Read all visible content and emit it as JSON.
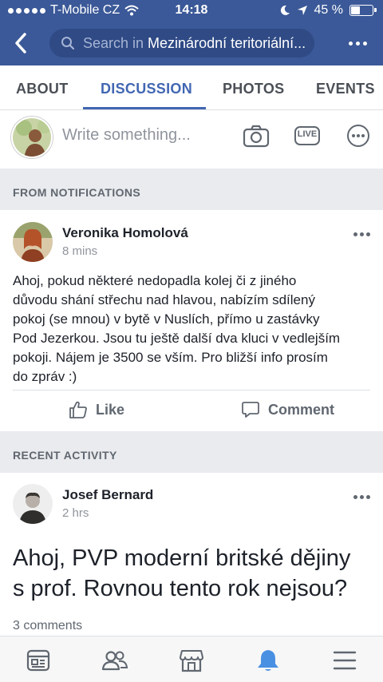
{
  "status_bar": {
    "carrier": "T-Mobile CZ",
    "time": "14:18",
    "battery": "45 %",
    "battery_level": 0.45
  },
  "header": {
    "search_prefix": "Search in",
    "search_page": "Mezinárodní teritoriální..."
  },
  "tabs": [
    {
      "label": "ABOUT"
    },
    {
      "label": "DISCUSSION"
    },
    {
      "label": "PHOTOS"
    },
    {
      "label": "EVENTS"
    }
  ],
  "active_tab": "DISCUSSION",
  "composer": {
    "placeholder": "Write something...",
    "live_label": "LIVE"
  },
  "sections": {
    "notifications": "FROM NOTIFICATIONS",
    "recent": "RECENT ACTIVITY"
  },
  "posts": [
    {
      "author": "Veronika Homolová",
      "time": "8 mins",
      "text_lines": [
        "Ahoj, pokud některé nedopadla kolej či z jiného",
        "důvodu shání střechu nad hlavou, nabízím sdílený",
        "pokoj (se mnou) v bytě v Nuslích, přímo u zastávky",
        "Pod Jezerkou. Jsou tu ještě další dva kluci v vedlejším",
        "pokoji. Nájem je 3500 se vším. Pro bližší info prosím",
        "do zpráv :)"
      ],
      "like_label": "Like",
      "comment_label": "Comment"
    },
    {
      "author": "Josef Bernard",
      "time": "2 hrs",
      "big_text_lines": [
        "Ahoj, PVP moderní britské dějiny",
        "s prof. Rovnou tento rok nejsou?"
      ],
      "comments": "3 comments"
    }
  ],
  "colors": {
    "brand": "#3b5998",
    "accent": "#4267b2",
    "notification_icon": "#4a90e2"
  },
  "bottom_nav": [
    {
      "icon": "news-feed-icon"
    },
    {
      "icon": "friends-icon"
    },
    {
      "icon": "marketplace-icon"
    },
    {
      "icon": "notifications-bell-icon"
    },
    {
      "icon": "menu-icon"
    }
  ]
}
